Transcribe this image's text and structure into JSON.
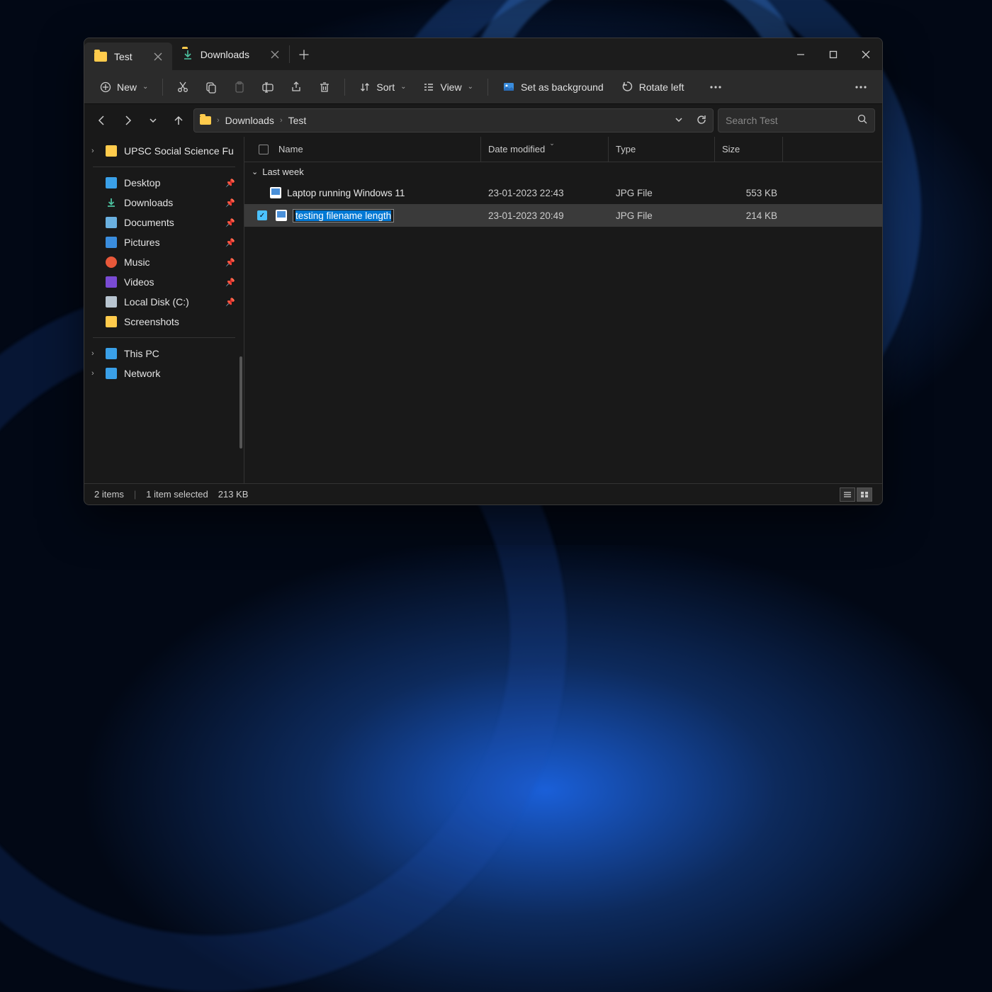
{
  "tabs": [
    {
      "label": "Test",
      "active": true
    },
    {
      "label": "Downloads",
      "active": false
    }
  ],
  "toolbar": {
    "new_label": "New",
    "sort_label": "Sort",
    "view_label": "View",
    "set_bg_label": "Set as background",
    "rotate_left_label": "Rotate left"
  },
  "breadcrumbs": [
    "Downloads",
    "Test"
  ],
  "search": {
    "placeholder": "Search Test"
  },
  "sidebar": {
    "top": [
      {
        "label": "UPSC Social Science Fu",
        "icon": "folder",
        "expand": true
      }
    ],
    "quick": [
      {
        "label": "Desktop",
        "icon": "desktop",
        "pinned": true
      },
      {
        "label": "Downloads",
        "icon": "download",
        "pinned": true
      },
      {
        "label": "Documents",
        "icon": "document",
        "pinned": true
      },
      {
        "label": "Pictures",
        "icon": "pictures",
        "pinned": true
      },
      {
        "label": "Music",
        "icon": "music",
        "pinned": true
      },
      {
        "label": "Videos",
        "icon": "videos",
        "pinned": true
      },
      {
        "label": "Local Disk (C:)",
        "icon": "disk",
        "pinned": true
      },
      {
        "label": "Screenshots",
        "icon": "folder",
        "pinned": false
      }
    ],
    "bottom": [
      {
        "label": "This PC",
        "icon": "pc",
        "expand": true
      },
      {
        "label": "Network",
        "icon": "network",
        "expand": true
      }
    ]
  },
  "columns": {
    "name": "Name",
    "date": "Date modified",
    "type": "Type",
    "size": "Size"
  },
  "group_label": "Last week",
  "files": [
    {
      "name": "Laptop running Windows 11",
      "date": "23-01-2023 22:43",
      "type": "JPG File",
      "size": "553 KB",
      "selected": false,
      "renaming": false
    },
    {
      "name": "testing filename length",
      "date": "23-01-2023 20:49",
      "type": "JPG File",
      "size": "214 KB",
      "selected": true,
      "renaming": true
    }
  ],
  "status": {
    "count": "2 items",
    "selected": "1 item selected",
    "sel_size": "213 KB"
  }
}
